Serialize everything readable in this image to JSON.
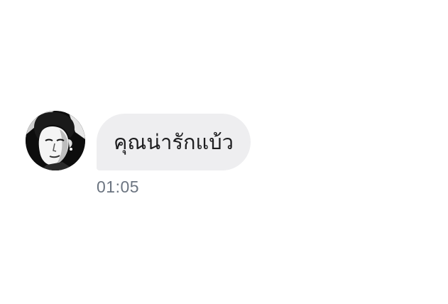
{
  "message": {
    "text": "คุณน่ารักแบ้ว",
    "timestamp": "01:05",
    "avatar_icon": "profile-photo-avatar"
  },
  "colors": {
    "bubble_background": "#eeeef0",
    "message_text": "#1c1c1e",
    "timestamp_text": "#6b7480",
    "page_background": "#ffffff"
  }
}
